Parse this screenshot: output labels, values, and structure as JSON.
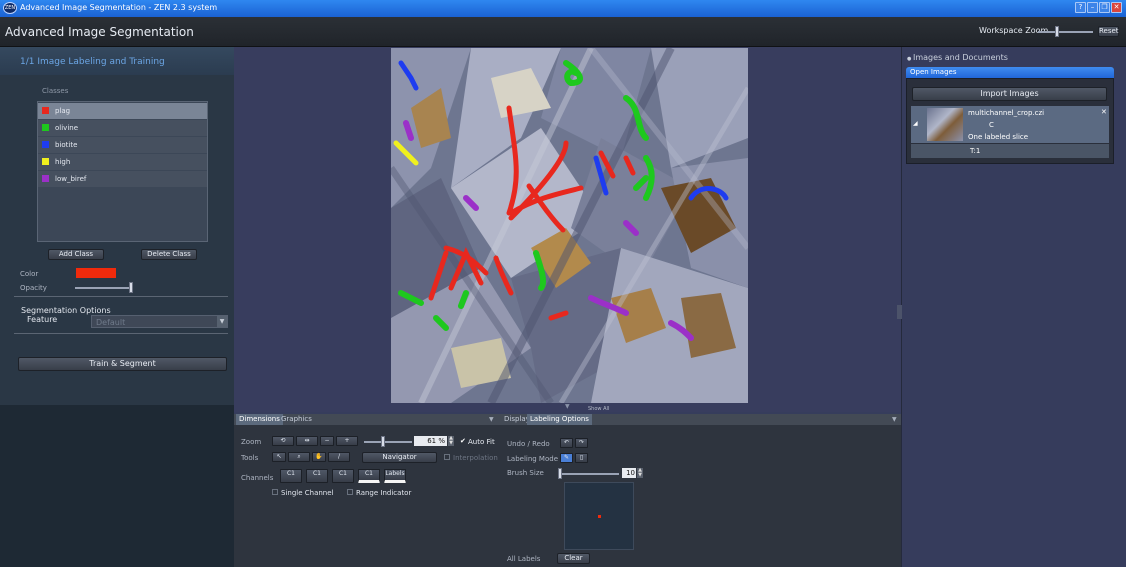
{
  "window": {
    "title": "Advanced Image Segmentation - ZEN 2.3 system",
    "logo_text": "ZEN",
    "help": "?",
    "minimize": "–",
    "maximize": "❐",
    "close": "✕"
  },
  "header": {
    "app_title": "Advanced Image Segmentation",
    "workspace_zoom_label": "Workspace Zoom",
    "reset_label": "Reset"
  },
  "left": {
    "step_title": "1/1  Image Labeling and Training",
    "classes_label": "Classes",
    "classes": [
      {
        "label": "plag",
        "color": "#e8281e"
      },
      {
        "label": "olivine",
        "color": "#1ec81e"
      },
      {
        "label": "biotite",
        "color": "#1e3cf0"
      },
      {
        "label": "high",
        "color": "#f0f01e"
      },
      {
        "label": "low_biref",
        "color": "#9b30c8"
      }
    ],
    "add_class": "Add Class",
    "delete_class": "Delete Class",
    "color_label": "Color",
    "selected_color": "#f02a0c",
    "opacity_label": "Opacity",
    "seg_options_label": "Segmentation Options",
    "feature_label": "Feature",
    "feature_value": "Default",
    "train_segment": "Train & Segment"
  },
  "center": {
    "show_all": "Show All"
  },
  "bottom": {
    "tabs_left": [
      "Dimensions",
      "Graphics"
    ],
    "tabs_right": [
      "Display",
      "Labeling Options"
    ],
    "zoom_label": "Zoom",
    "zoom_value": "61 %",
    "auto_fit": "Auto Fit",
    "tools_label": "Tools",
    "navigator": "Navigator",
    "interpolation": "Interpolation",
    "channels_label": "Channels",
    "channel_buttons": [
      "C1",
      "C1",
      "C1",
      "C1",
      "Labels"
    ],
    "single_channel": "Single Channel",
    "range_indicator": "Range Indicator",
    "undo_redo_label": "Undo / Redo",
    "labeling_mode_label": "Labeling Mode",
    "brush_size_label": "Brush Size",
    "brush_size_value": "10",
    "all_labels_label": "All Labels",
    "clear": "Clear"
  },
  "right": {
    "section_title": "Images and Documents",
    "open_images": "Open Images",
    "import_images": "Import Images",
    "file_name": "multichannel_crop.czi",
    "channel": "C",
    "slice_info": "One labeled slice",
    "time_label": "T:1"
  }
}
